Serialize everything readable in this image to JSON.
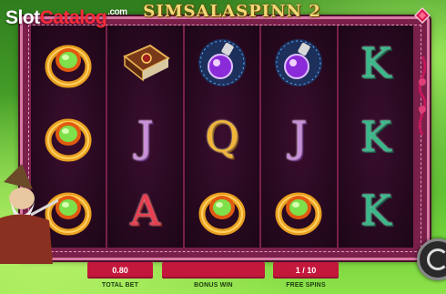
{
  "branding": {
    "logo_part1": "Slot",
    "logo_part2": "Catalog",
    "logo_suffix": ".com",
    "game_title": "SIMSALASPINN 2"
  },
  "reels": [
    [
      "ring",
      "ring",
      "ring"
    ],
    [
      "spellbook",
      "J",
      "A"
    ],
    [
      "potion",
      "Q",
      "ring"
    ],
    [
      "potion",
      "J",
      "ring"
    ],
    [
      "K",
      "K",
      "K"
    ]
  ],
  "bottom_bar": {
    "total_bet_value": "0.80",
    "total_bet_label": "TOTAL BET",
    "bonus_win_value": "",
    "bonus_win_label": "BONUS WIN",
    "free_spins_value": "1 / 10",
    "free_spins_label": "FREE SPINS"
  },
  "colors": {
    "frame": "#7a1f4a",
    "value_box": "#c4173c",
    "background": "#4aa52a"
  },
  "icons": {
    "spin": "spin-icon",
    "ring": "ring-icon",
    "spellbook": "spellbook-icon",
    "potion": "potion-icon"
  }
}
